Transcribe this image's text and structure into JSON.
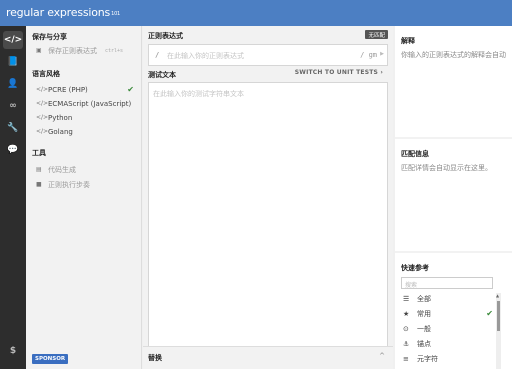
{
  "header": {
    "logo_regular": "regular",
    "logo_expressions": " expressions",
    "logo_version": "101"
  },
  "iconbar": {
    "items": [
      "</>",
      "📘",
      "👤",
      "∞",
      "🔧",
      "💬"
    ],
    "donate": "$"
  },
  "sidebar": {
    "save_share_title": "保存与分享",
    "save_regex": "保存正则表达式",
    "save_shortcut": "ctrl+s",
    "flavor_title": "语言风格",
    "flavors": [
      "PCRE (PHP)",
      "ECMAScript (JavaScript)",
      "Python",
      "Golang"
    ],
    "selected_flavor_check": "✔",
    "tools_title": "工具",
    "tools": [
      "代码生成",
      "正则执行步奏"
    ],
    "sponsor": "SPONSOR"
  },
  "main": {
    "regex_title": "正则表达式",
    "no_match": "无匹配",
    "delimiter_open": "/",
    "regex_placeholder": "在此输入你的正则表达式",
    "flags": "/ gm",
    "test_title": "测试文本",
    "unit_tests_link": "SWITCH TO UNIT TESTS ›",
    "test_placeholder": "在此输入你的测试字符串文本",
    "replace_title": "替换",
    "replace_chevron": "^"
  },
  "right": {
    "explanation_title": "解释",
    "explanation_text": "你输入的正则表达式的解释会自动",
    "match_info_title": "匹配信息",
    "match_info_text": "匹配详情会自动显示在这里。",
    "quick_ref_title": "快速参考",
    "quick_ref_search": "搜索",
    "quick_ref_items": [
      {
        "icon": "☰",
        "label": "全部"
      },
      {
        "icon": "★",
        "label": "常用",
        "check": "✔"
      },
      {
        "icon": "⊙",
        "label": "一般"
      },
      {
        "icon": "⚓",
        "label": "锚点"
      },
      {
        "icon": "≡",
        "label": "元字符"
      }
    ]
  }
}
